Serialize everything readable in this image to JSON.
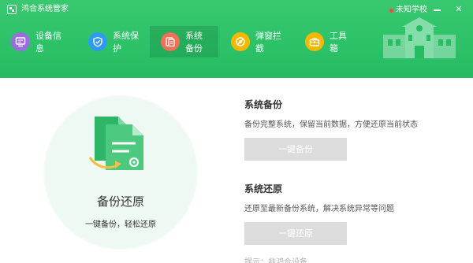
{
  "window": {
    "app_title": "鸿合系统管家",
    "school_label": "未知学校",
    "minimize_symbol": "",
    "close_symbol": "✕"
  },
  "nav": {
    "items": [
      {
        "label": "设备信息",
        "icon": "monitor-icon",
        "color": "#9b6ee0"
      },
      {
        "label": "系统保护",
        "icon": "shield-icon",
        "color": "#2f9bf0"
      },
      {
        "label": "系统备份",
        "icon": "backup-icon",
        "color": "#f0705a",
        "active": true
      },
      {
        "label": "弹窗拦截",
        "icon": "popup-block-icon",
        "color": "#f5b800"
      },
      {
        "label": "工具箱",
        "icon": "toolbox-icon",
        "color": "#f5b800"
      }
    ]
  },
  "left_panel": {
    "title": "备份还原",
    "subtitle": "一键备份，轻松还原"
  },
  "backup": {
    "title": "系统备份",
    "description": "备份完整系统，保留当前数据，方便还原当前状态",
    "button_label": "一键备份"
  },
  "restore": {
    "title": "系统还原",
    "description": "还原至最新备份系统，解决系统异常等问题",
    "button_label": "一键还原"
  },
  "tip": "提示：非鸿合设备",
  "colors": {
    "header_green": "#2cc268",
    "button_gray": "#dcdcdc",
    "accent_green": "#3bbf73"
  }
}
